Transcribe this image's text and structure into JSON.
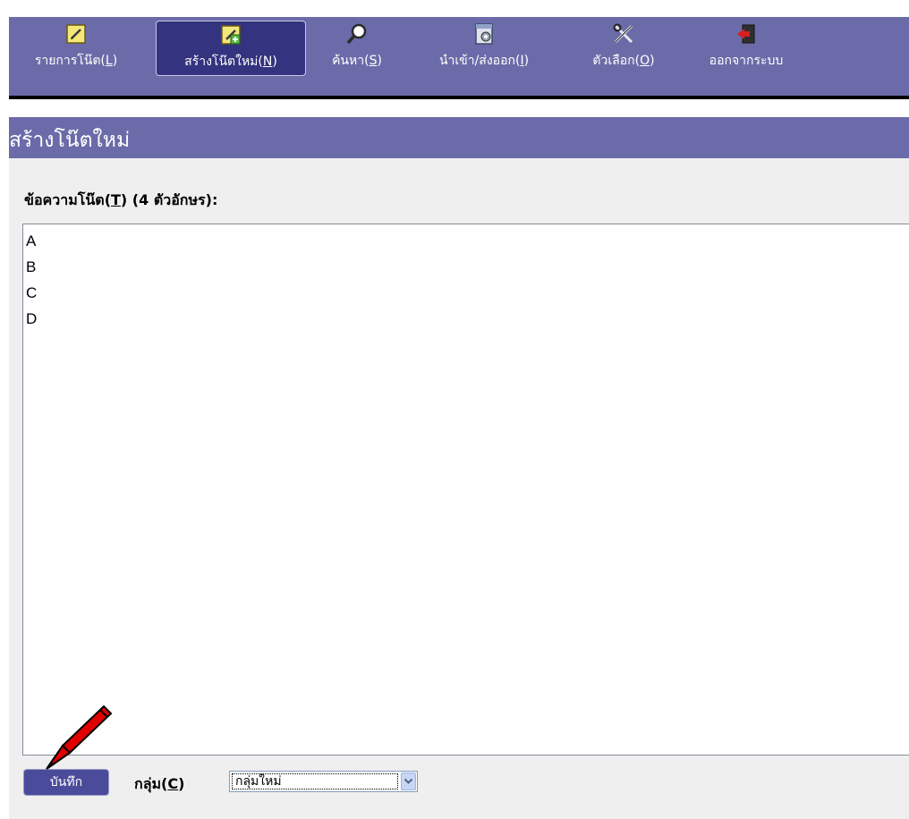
{
  "toolbar": {
    "items": [
      {
        "label": "รายการโน๊ต(",
        "mnemonic": "L",
        "suffix": ")",
        "icon": "note-list-icon"
      },
      {
        "label": "สร้างโน๊ตใหม่(",
        "mnemonic": "N",
        "suffix": ")",
        "icon": "new-note-icon",
        "active": true
      },
      {
        "label": "ค้นหา(",
        "mnemonic": "S",
        "suffix": ")",
        "icon": "search-icon"
      },
      {
        "label": "นำเข้า/ส่งออก(",
        "mnemonic": "I",
        "suffix": ")",
        "icon": "import-export-icon"
      },
      {
        "label": "ตัวเลือก(",
        "mnemonic": "O",
        "suffix": ")",
        "icon": "options-tools-icon"
      },
      {
        "label": "ออกจากระบบ",
        "mnemonic": "",
        "suffix": "",
        "icon": "logout-icon"
      }
    ]
  },
  "section": {
    "title": "สร้างโน๊ตใหม่"
  },
  "note": {
    "label_prefix": "ข้อความโน๊ต(",
    "label_mnemonic": "T",
    "label_suffix": ") (4 ตัวอักษร):",
    "text": "A\nB\nC\nD"
  },
  "footer": {
    "save_label": "บันทึก",
    "group_label_prefix": "กลุ่ม(",
    "group_label_mnemonic": "C",
    "group_label_suffix": ")",
    "group_selected": "กลุ่มใหม่"
  },
  "colors": {
    "toolbar_bg": "#6b6ba9",
    "active_item_bg": "#33337f",
    "content_bg": "#efefef",
    "save_button_bg": "#4b4b9b",
    "marker": "#e00000"
  }
}
